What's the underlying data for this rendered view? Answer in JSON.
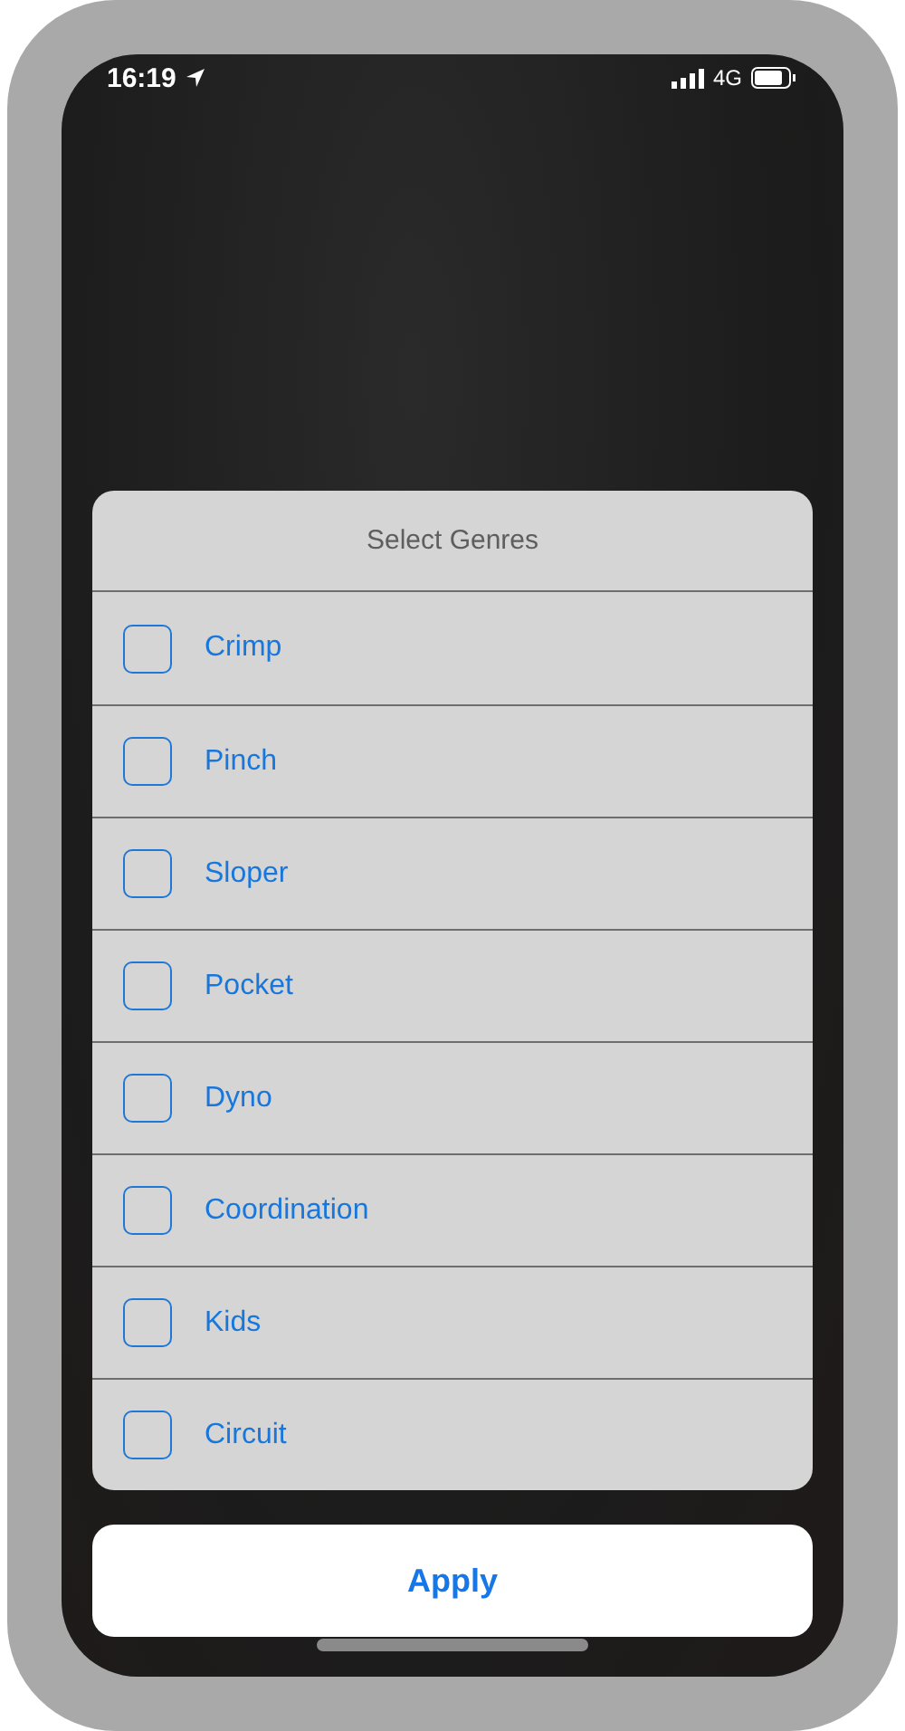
{
  "status_bar": {
    "time": "16:19",
    "network": "4G"
  },
  "sheet": {
    "title": "Select Genres",
    "options": [
      {
        "label": "Crimp",
        "checked": false
      },
      {
        "label": "Pinch",
        "checked": false
      },
      {
        "label": "Sloper",
        "checked": false
      },
      {
        "label": "Pocket",
        "checked": false
      },
      {
        "label": "Dyno",
        "checked": false
      },
      {
        "label": "Coordination",
        "checked": false
      },
      {
        "label": "Kids",
        "checked": false
      },
      {
        "label": "Circuit",
        "checked": false
      }
    ]
  },
  "apply_button": {
    "label": "Apply"
  }
}
